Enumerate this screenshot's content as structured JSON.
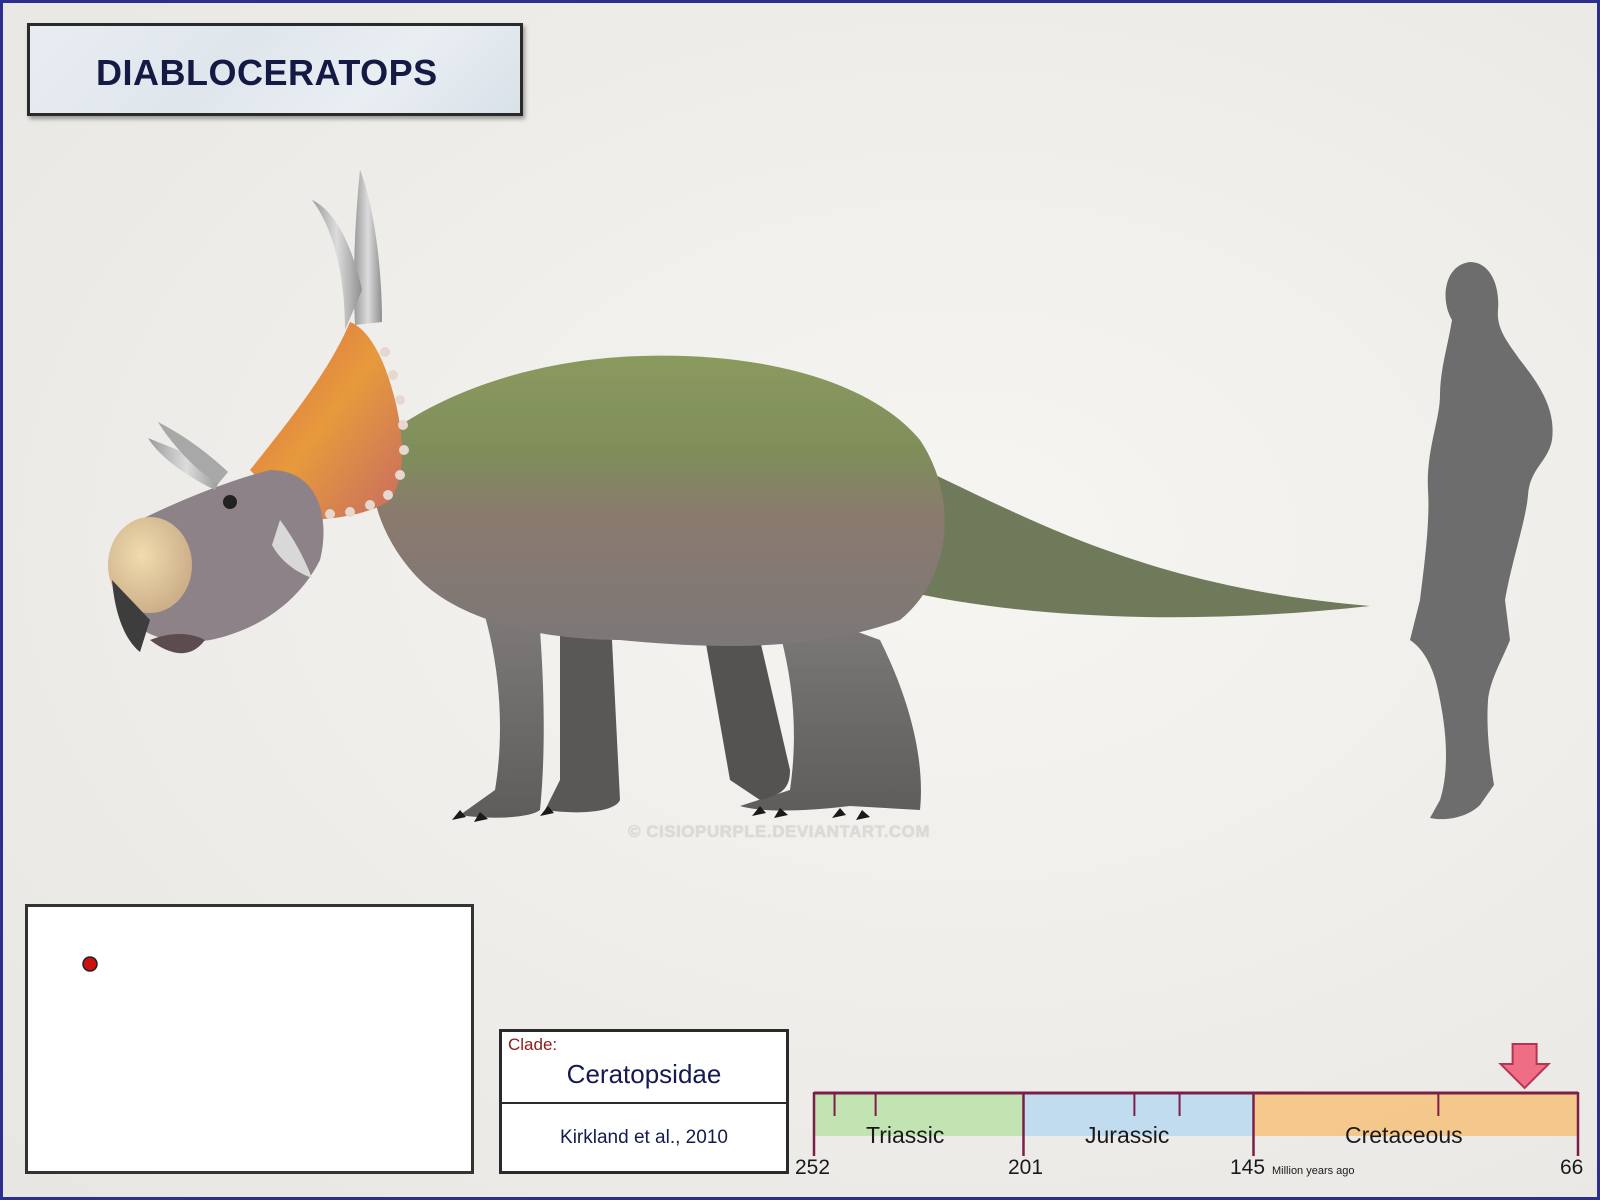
{
  "title": "DIABLOCERATOPS",
  "watermark": "© CISIOPURPLE.DEVIANTART.COM",
  "clade": {
    "label": "Clade:",
    "name": "Ceratopsidae",
    "author": "Kirkland et al., 2010"
  },
  "timeline": {
    "periods": [
      "Triassic",
      "Jurassic",
      "Cretaceous"
    ],
    "ticks": [
      "252",
      "201",
      "145",
      "66"
    ],
    "unit_label": "Million years ago",
    "marker_ma": 79,
    "colors": {
      "axis": "#7b1f4a",
      "triassic": "#b8e3a8",
      "jurassic": "#b7d9ee",
      "cretaceous": "#f6c27a",
      "marker": "#ef6e86"
    }
  },
  "map": {
    "locality_color": "#cc1010"
  },
  "colors": {
    "border": "#2b2f8f",
    "title_text": "#141a44"
  }
}
